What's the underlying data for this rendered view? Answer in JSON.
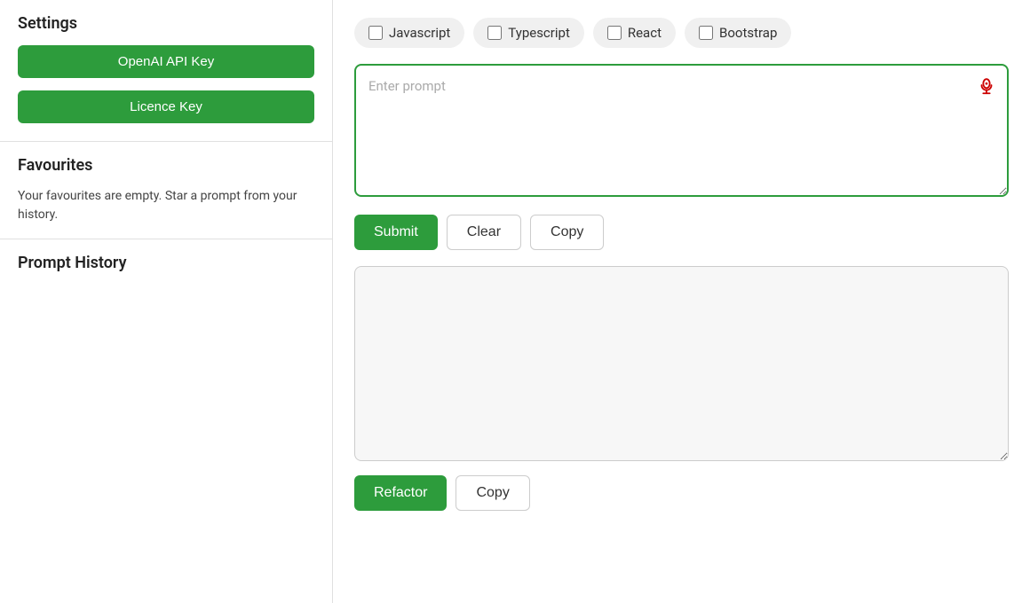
{
  "sidebar": {
    "settings_title": "Settings",
    "openai_btn": "OpenAI API Key",
    "licence_btn": "Licence Key",
    "favourites_title": "Favourites",
    "favourites_empty": "Your favourites are empty. Star a prompt from your history.",
    "history_title": "Prompt History"
  },
  "main": {
    "checkboxes": [
      {
        "label": "Javascript",
        "checked": false
      },
      {
        "label": "Typescript",
        "checked": false
      },
      {
        "label": "React",
        "checked": false
      },
      {
        "label": "Bootstrap",
        "checked": false
      }
    ],
    "prompt_placeholder": "Enter prompt",
    "submit_label": "Submit",
    "clear_label": "Clear",
    "copy_label": "Copy",
    "refactor_label": "Refactor",
    "copy_bottom_label": "Copy",
    "output_value": ""
  },
  "icons": {
    "mic": "🎙️"
  }
}
